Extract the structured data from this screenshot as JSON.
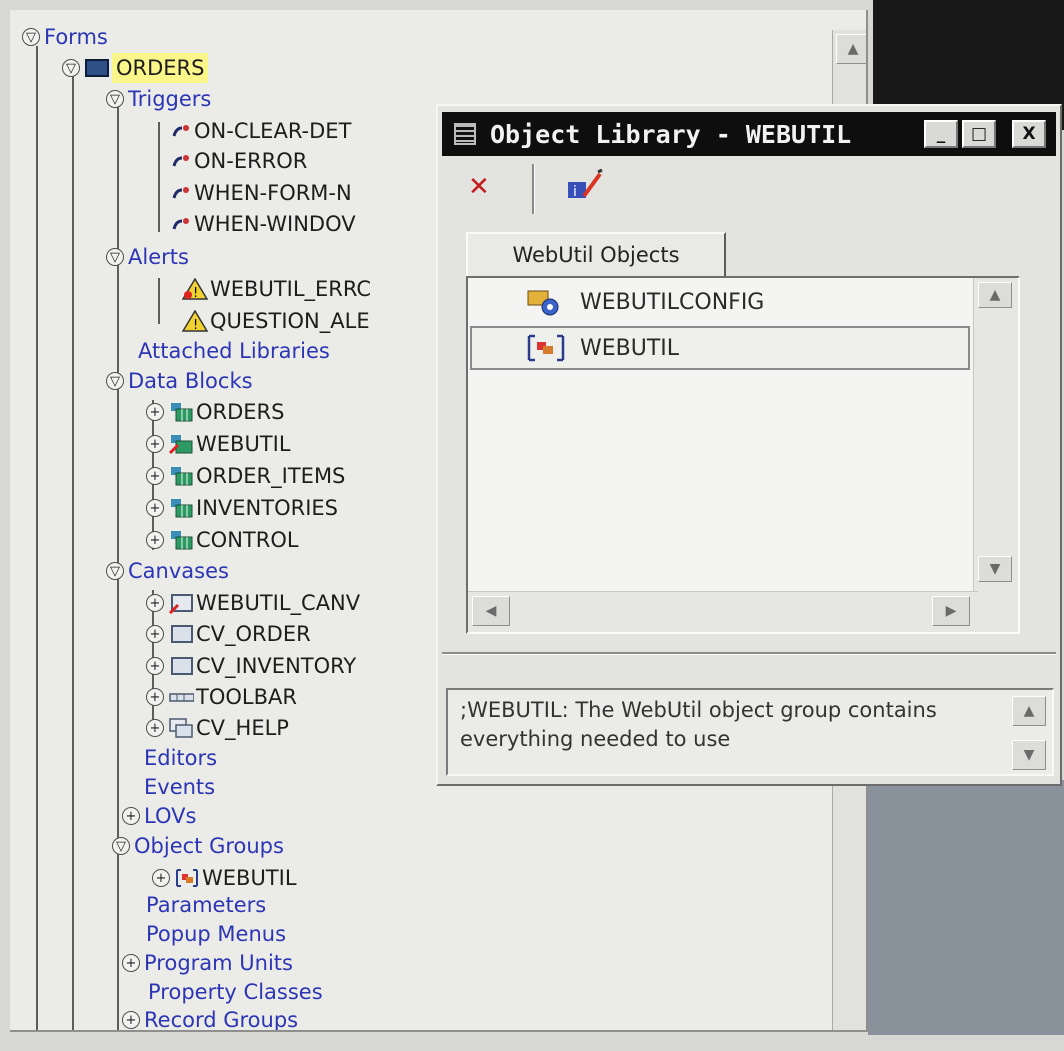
{
  "navigator": {
    "forms": "Forms",
    "module": "ORDERS",
    "triggers": {
      "label": "Triggers",
      "items": [
        "ON-CLEAR-DET",
        "ON-ERROR",
        "WHEN-FORM-N",
        "WHEN-WINDOV"
      ]
    },
    "alerts": {
      "label": "Alerts",
      "items": [
        "WEBUTIL_ERRC",
        "QUESTION_ALE"
      ]
    },
    "attached_libraries": "Attached Libraries",
    "data_blocks": {
      "label": "Data Blocks",
      "items": [
        "ORDERS",
        "WEBUTIL",
        "ORDER_ITEMS",
        "INVENTORIES",
        "CONTROL"
      ]
    },
    "canvases": {
      "label": "Canvases",
      "items": [
        "WEBUTIL_CANV",
        "CV_ORDER",
        "CV_INVENTORY",
        "TOOLBAR",
        "CV_HELP"
      ]
    },
    "editors": "Editors",
    "events": "Events",
    "lovs": "LOVs",
    "object_groups": {
      "label": "Object Groups",
      "items": [
        "WEBUTIL"
      ]
    },
    "parameters": "Parameters",
    "popup_menus": "Popup Menus",
    "program_units": "Program Units",
    "property_classes": "Property Classes",
    "record_groups": "Record Groups"
  },
  "object_library": {
    "title": "Object Library - WEBUTIL",
    "window_buttons": [
      "_",
      "□",
      "X"
    ],
    "tab": "WebUtil Objects",
    "items": [
      "WEBUTILCONFIG",
      "WEBUTIL"
    ],
    "description": "WEBUTIL: The WebUtil object group contains everything needed to use",
    "description_prefix": ";"
  },
  "icons": {
    "collapse": "minus-circle",
    "expand": "plus-circle",
    "trigger": "trigger-icon",
    "alert": "warning-triangle-icon",
    "block": "data-block-icon",
    "canvas": "canvas-icon"
  },
  "colors": {
    "folder_text": "#2c35b4",
    "highlight": "#fbf68a",
    "title_bar": "#0e0e0e"
  }
}
